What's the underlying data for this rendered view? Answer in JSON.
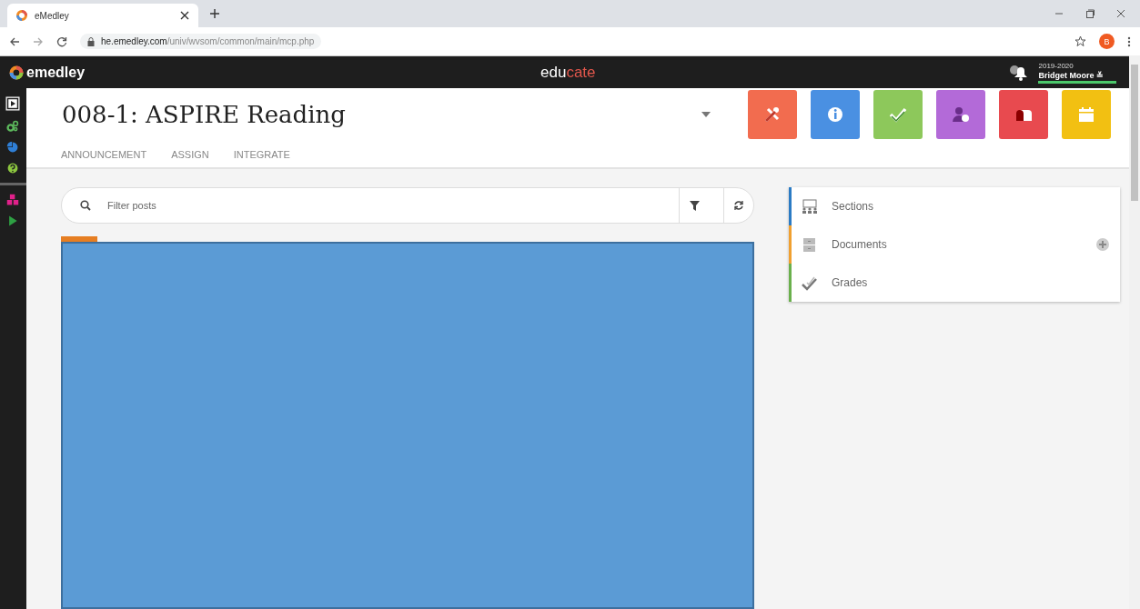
{
  "browser": {
    "tab_title": "eMedley",
    "url": "**he.emedley.com**/univ/wvsom/common/main/mcp.php",
    "profile_initial": "B"
  },
  "header": {
    "logo": "emedley",
    "app_name": [
      {
        "text": "edu",
        "color": "#ffffff"
      },
      {
        "text": "cate",
        "color": "#e2574c"
      }
    ],
    "year": "2019-2020",
    "user": "Bridget Moore ≚"
  },
  "sidebar": {
    "items": [
      {
        "kind": "play-box",
        "color": "#ffffff",
        "selected": true
      },
      {
        "kind": "gears",
        "color": "#5cb85c",
        "selected": false
      },
      {
        "kind": "pie",
        "color": "#2f7fd6",
        "selected": false
      },
      {
        "kind": "help",
        "color": "#8cc63f",
        "selected": false
      },
      {
        "kind": "cubes",
        "color": "#e0218a",
        "selected": false
      },
      {
        "kind": "play",
        "color": "#2ea043",
        "selected": false
      }
    ]
  },
  "course": {
    "title": "008-1: ASPIRE Reading"
  },
  "tools": [
    {
      "kind": "tools",
      "color": "#f26c4f"
    },
    {
      "kind": "info",
      "color": "#4a90e2"
    },
    {
      "kind": "check",
      "color": "#8dc85b"
    },
    {
      "kind": "user-clock",
      "color": "#b36ad8"
    },
    {
      "kind": "mailbox",
      "color": "#e84a4f"
    },
    {
      "kind": "calendar",
      "color": "#f2c012"
    }
  ],
  "tabs": [
    {
      "label": "ANNOUNCEMENT",
      "selected": false
    },
    {
      "label": "ASSIGN",
      "selected": false
    },
    {
      "label": "INTEGRATE",
      "selected": false
    }
  ],
  "search": {
    "placeholder": "Filter posts"
  },
  "panel": {
    "items": [
      {
        "kind": "sections",
        "label": "Sections",
        "color": "#2b7bc4",
        "addable": false
      },
      {
        "kind": "documents",
        "label": "Documents",
        "color": "#f0a030",
        "addable": true
      },
      {
        "kind": "grades",
        "label": "Grades",
        "color": "#6ab04c",
        "addable": false
      }
    ]
  }
}
